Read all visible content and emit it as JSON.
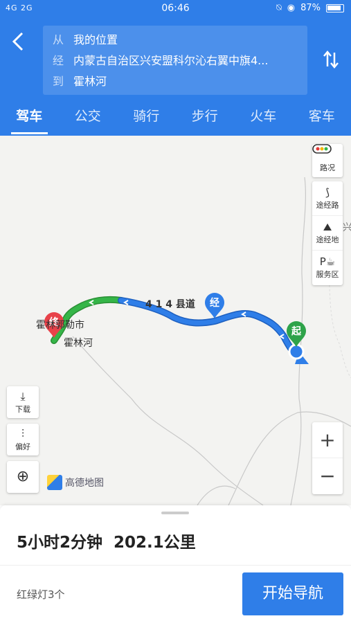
{
  "status_bar": {
    "signal": "4G 2G",
    "time": "06:46",
    "battery": "87%"
  },
  "header": {
    "from_tag": "从",
    "from": "我的位置",
    "via_tag": "经",
    "via": "内蒙古自治区兴安盟科尔沁右翼中旗4...",
    "to_tag": "到",
    "to": "霍林河"
  },
  "tabs": [
    {
      "label": "驾车",
      "active": true
    },
    {
      "label": "公交"
    },
    {
      "label": "骑行"
    },
    {
      "label": "步行"
    },
    {
      "label": "火车"
    },
    {
      "label": "客车"
    }
  ],
  "map": {
    "side_buttons": [
      {
        "label": "路况",
        "icon": "traffic-icon"
      },
      {
        "label": "途经路",
        "icon": "waypoint-road-icon"
      },
      {
        "label": "途经地",
        "icon": "waypoint-place-icon"
      },
      {
        "label": "服务区",
        "icon": "service-area-icon"
      }
    ],
    "download_label": "下载",
    "preference_label": "偏好",
    "logo_text": "高德地图",
    "city_label": "霍林郭勒市",
    "end_label": "霍林河",
    "end_marker": "终",
    "start_marker": "起",
    "via_marker": "经",
    "road_label": "4 1 4 县道",
    "zoom_in": "+",
    "zoom_out": "−",
    "edge_label": "兴",
    "route_color": "#2f7ee8",
    "congestion_color": "#35b548"
  },
  "summary": {
    "duration": "5小时2分钟",
    "distance": "202.1公里",
    "traffic_lights": "红绿灯3个",
    "start_button": "开始导航"
  }
}
